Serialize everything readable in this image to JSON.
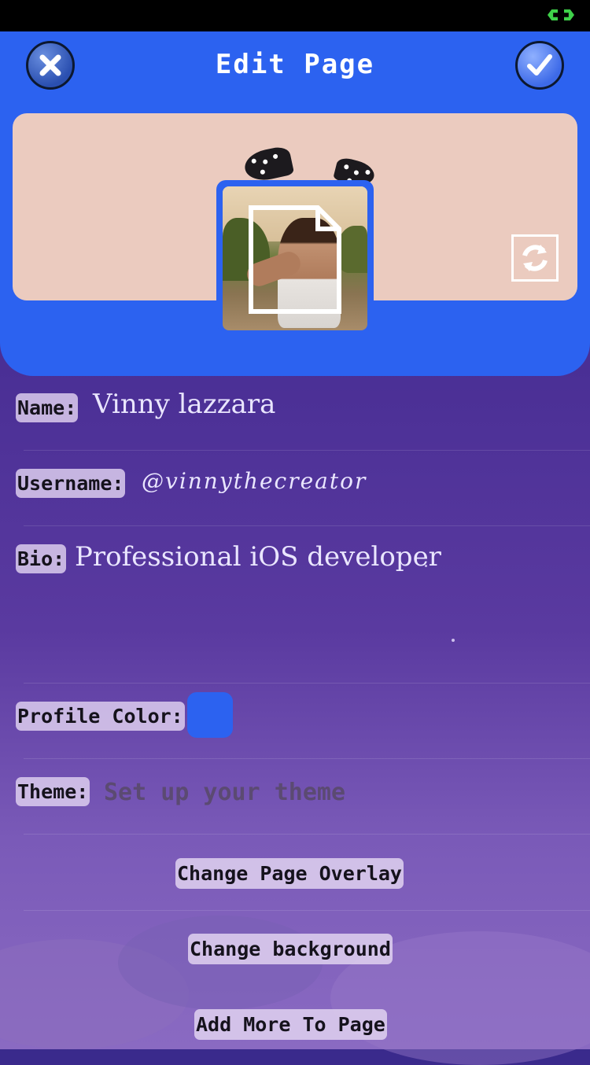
{
  "header": {
    "title": "Edit Page",
    "close_icon": "close-icon",
    "done_icon": "checkmark-icon",
    "accent_color": "#2c62f0"
  },
  "banner": {
    "background_color": "#ebcbbf",
    "refresh_icon": "refresh-icon"
  },
  "avatar": {
    "frame_color": "#2c62f0",
    "overlay_icon": "file-icon"
  },
  "form": {
    "name": {
      "label": "Name:",
      "value": "Vinny lazzara"
    },
    "username": {
      "label": "Username:",
      "value": "@vinnythecreator"
    },
    "bio": {
      "label": "Bio:",
      "value": "Professional iOS developer"
    },
    "profile_color": {
      "label": "Profile Color:",
      "value_color": "#2c62f0"
    },
    "theme": {
      "label": "Theme:",
      "placeholder": "Set up your theme"
    }
  },
  "actions": {
    "change_overlay": "Change Page Overlay",
    "change_background": "Change background",
    "add_more": "Add More To Page"
  }
}
